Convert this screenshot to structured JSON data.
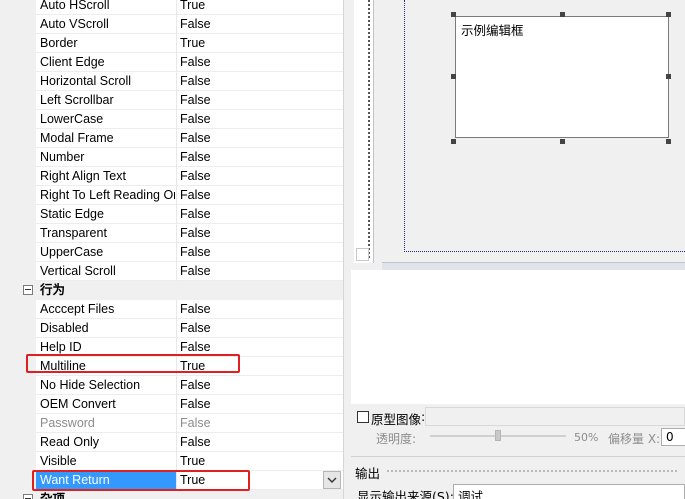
{
  "property_grid": {
    "rows_top": [
      {
        "name": "Auto HScroll",
        "value": "True"
      },
      {
        "name": "Auto VScroll",
        "value": "False"
      },
      {
        "name": "Border",
        "value": "True"
      },
      {
        "name": "Client Edge",
        "value": "False"
      },
      {
        "name": "Horizontal Scroll",
        "value": "False"
      },
      {
        "name": "Left Scrollbar",
        "value": "False"
      },
      {
        "name": "LowerCase",
        "value": "False"
      },
      {
        "name": "Modal Frame",
        "value": "False"
      },
      {
        "name": "Number",
        "value": "False"
      },
      {
        "name": "Right Align Text",
        "value": "False"
      },
      {
        "name": "Right To Left Reading Order",
        "value": "False"
      },
      {
        "name": "Static Edge",
        "value": "False"
      },
      {
        "name": "Transparent",
        "value": "False"
      },
      {
        "name": "UpperCase",
        "value": "False"
      },
      {
        "name": "Vertical Scroll",
        "value": "False"
      }
    ],
    "category_behavior": "行为",
    "rows_behavior": [
      {
        "name": "Acccept Files",
        "value": "False"
      },
      {
        "name": "Disabled",
        "value": "False"
      },
      {
        "name": "Help ID",
        "value": "False"
      },
      {
        "name": "Multiline",
        "value": "True"
      },
      {
        "name": "No Hide Selection",
        "value": "False"
      },
      {
        "name": "OEM Convert",
        "value": "False"
      },
      {
        "name": "Password",
        "value": "False"
      },
      {
        "name": "Read Only",
        "value": "False"
      },
      {
        "name": "Visible",
        "value": "True"
      },
      {
        "name": "Want Return",
        "value": "True"
      }
    ],
    "category_misc": "杂项"
  },
  "designer": {
    "edit_text": "示例编辑框"
  },
  "prototype": {
    "checkbox_label": "原型图像",
    "transparency_label": "透明度:",
    "transparency_value": "50%",
    "offset_label": "偏移量 X:",
    "offset_value": "0"
  },
  "output": {
    "title": "输出",
    "source_label": "显示输出来源(S):",
    "source_value": "调试"
  },
  "colors": {
    "selection": "#3399ff",
    "highlight_box": "#e02020"
  }
}
